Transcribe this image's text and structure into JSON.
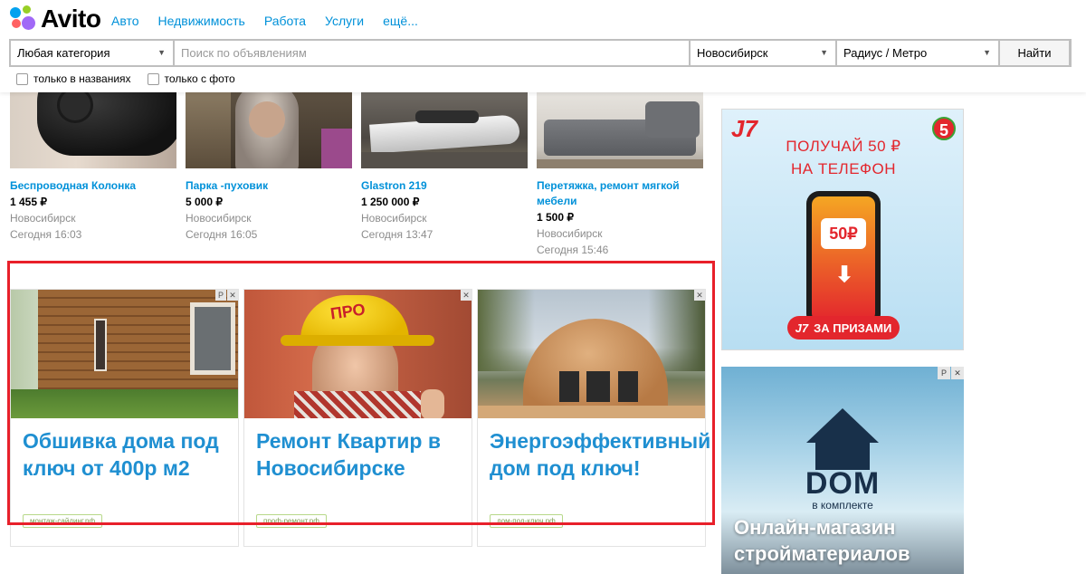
{
  "brand": {
    "name": "Avito"
  },
  "nav": {
    "items": [
      "Авто",
      "Недвижимость",
      "Работа",
      "Услуги",
      "ещё..."
    ]
  },
  "search": {
    "category": "Любая категория",
    "placeholder": "Поиск по объявлениям",
    "city": "Новосибирск",
    "radius": "Радиус / Метро",
    "button": "Найти",
    "only_titles": "только в названиях",
    "only_photo": "только с фото",
    "only_titles_checked": false,
    "only_photo_checked": false
  },
  "listings": [
    {
      "title": "Беспроводная Колонка",
      "price": "1 455 ₽",
      "city": "Новосибирск",
      "date": "Сегодня 16:03",
      "icon": "speaker-photo"
    },
    {
      "title": "Парка -пуховик",
      "price": "5 000 ₽",
      "city": "Новосибирск",
      "date": "Сегодня 16:05",
      "icon": "jacket-photo"
    },
    {
      "title": "Glastron 219",
      "price": "1 250 000 ₽",
      "city": "Новосибирск",
      "date": "Сегодня 13:47",
      "icon": "boat-photo"
    },
    {
      "title": "Перетяжка, ремонт мягкой мебели",
      "price": "1 500 ₽",
      "city": "Новосибирск",
      "date": "Сегодня 15:46",
      "icon": "sofa-photo"
    }
  ],
  "ads": [
    {
      "headline": "Обшивка дома под ключ от 400р м2",
      "domain": "монтаж-сайдинг.рф",
      "icon": "house-siding-photo"
    },
    {
      "headline": "Ремонт Квартир в Новосибирске",
      "domain": "проф-ремонт.рф",
      "icon": "builder-photo",
      "helmet_text": "ПРО"
    },
    {
      "headline": "Энергоэффективный дом под ключ!",
      "domain": "дом-под-ключ.рф",
      "icon": "dome-house-photo"
    }
  ],
  "side_ads": {
    "j7": {
      "logo": "J7",
      "headline": "ПОЛУЧАЙ 50 ₽\nНА ТЕЛЕФОН",
      "phone_value": "50₽",
      "cta": "ЗА ПРИЗАМИ",
      "cta_logo": "J7",
      "badge": "5",
      "accent": "#e3262d"
    },
    "dom": {
      "logo": "DOM",
      "logo_sub": "в комплекте",
      "headline": "Онлайн-магазин стройматериалов",
      "bg": "#7fb9d8"
    }
  },
  "ad_controls": {
    "r": "Р",
    "close": "✕"
  },
  "colors": {
    "link": "#0091d9",
    "ad_head": "#1f8fd1",
    "highlight": "#e8202a"
  }
}
